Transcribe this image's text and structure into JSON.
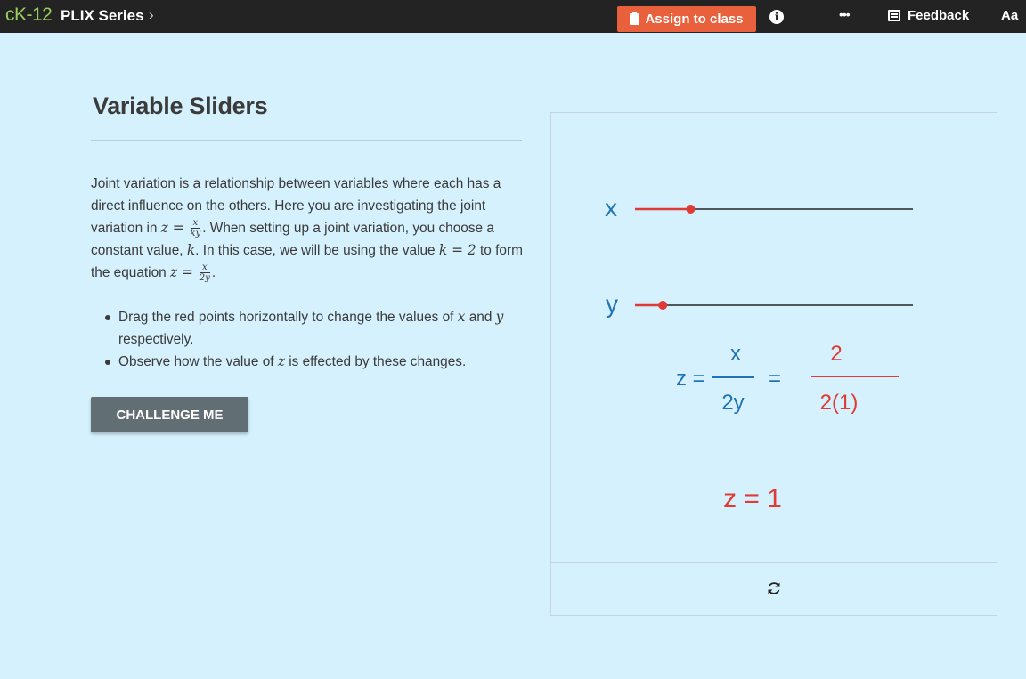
{
  "topbar": {
    "brand_logo": "cK-12",
    "series_label": "PLIX Series",
    "chevron": "›",
    "assign_label": "Assign to class",
    "info_icon": "i",
    "more_icon": "•••",
    "feedback_label": "Feedback",
    "font_toggle": "Aa",
    "colors": {
      "bar": "#232323",
      "assign": "#e8603c",
      "logo": "#9acd5c"
    }
  },
  "content": {
    "title": "Variable Sliders",
    "para": {
      "t1": "Joint variation is a relationship between variables where each has a direct influence on the others. Here you are investigating the joint variation in ",
      "eq1_lhs": "z = ",
      "eq1_num": "x",
      "eq1_den": "ky",
      "t2": ". When setting up a joint variation, you choose a constant value, ",
      "k_var": "k",
      "t3": ". In this case, we will be using the value ",
      "k_eq": "k = 2",
      "t4": " to form the equation ",
      "eq2_lhs": "z = ",
      "eq2_num": "x",
      "eq2_den": "2y",
      "t5": "."
    },
    "bullets": {
      "b1_a": "Drag the red points horizontally to change the values of ",
      "b1_x": "x",
      "b1_b": " and ",
      "b1_y": "y",
      "b1_c": " respectively.",
      "b2_a": "Observe how the value of ",
      "b2_z": "z",
      "b2_b": " is effected by these changes."
    },
    "challenge_label": "CHALLENGE ME"
  },
  "interactive": {
    "x_label": "x",
    "y_label": "y",
    "x_value_fraction": 0.2,
    "y_value_fraction": 0.1,
    "eq_z": "z =",
    "eq_num": "x",
    "eq_den": "2y",
    "eq_equals": "=",
    "val_num": "2",
    "val_den": "2(1)",
    "result": "z = 1",
    "reset_icon": "refresh-icon",
    "colors": {
      "blue": "#2173b8",
      "red": "#e03a34",
      "track": "#222222"
    }
  }
}
